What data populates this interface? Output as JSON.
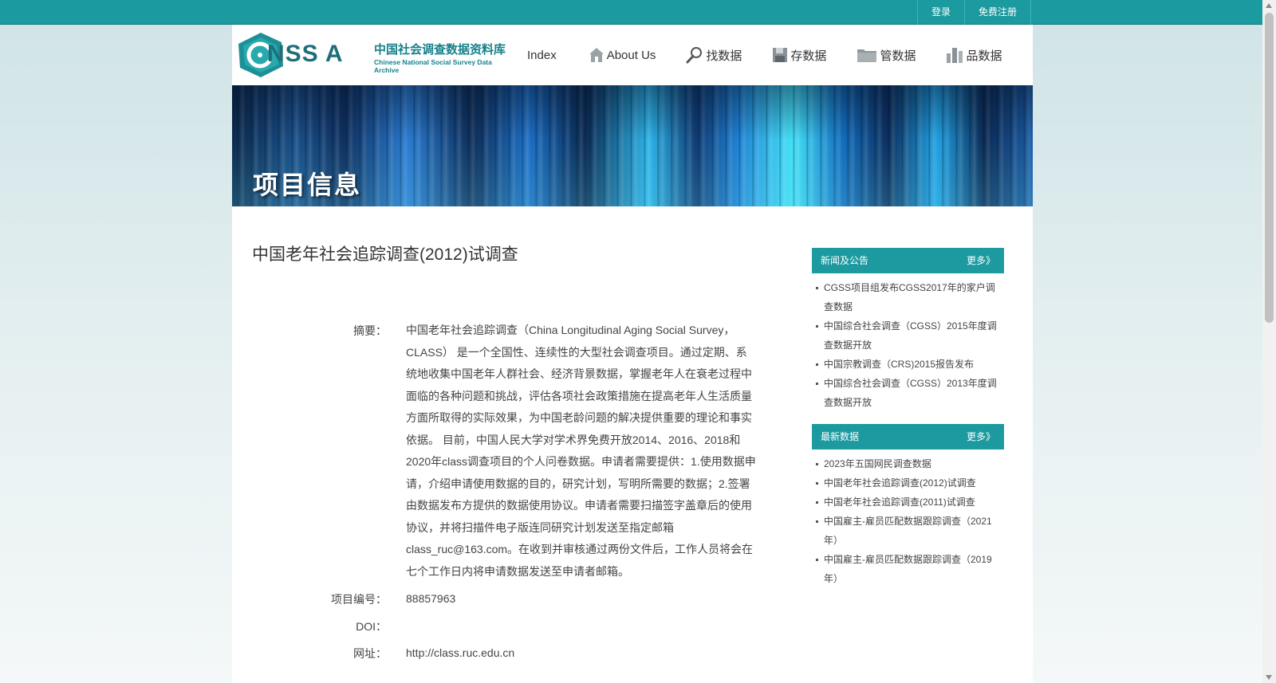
{
  "topbar": {
    "login": "登录",
    "register": "免费注册"
  },
  "logo": {
    "letters": "NSS  A",
    "cn_name": "中国社会调查数据资料库",
    "en_name": "Chinese National Social Survey Data Archive"
  },
  "nav": {
    "items": [
      {
        "label": "Index",
        "icon": "none"
      },
      {
        "label": "About Us",
        "icon": "home-icon"
      },
      {
        "label": "找数据",
        "icon": "search-icon"
      },
      {
        "label": "存数据",
        "icon": "save-icon"
      },
      {
        "label": "管数据",
        "icon": "folder-icon"
      },
      {
        "label": "品数据",
        "icon": "chart-icon"
      }
    ]
  },
  "banner": {
    "title": "项目信息"
  },
  "project": {
    "title": "中国老年社会追踪调查(2012)试调查",
    "abstract_label": "摘要：",
    "abstract": "中国老年社会追踪调查（China Longitudinal Aging Social Survey，CLASS） 是一个全国性、连续性的大型社会调查项目。通过定期、系统地收集中国老年人群社会、经济背景数据，掌握老年人在衰老过程中面临的各种问题和挑战，评估各项社会政策措施在提高老年人生活质量方面所取得的实际效果，为中国老龄问题的解决提供重要的理论和事实依据。 目前，中国人民大学对学术界免费开放2014、2016、2018和2020年class调查项目的个人问卷数据。申请者需要提供：1.使用数据申请，介绍申请使用数据的目的，研究计划，写明所需要的数据；2.签署由数据发布方提供的数据使用协议。申请者需要扫描签字盖章后的使用协议，并将扫描件电子版连同研究计划发送至指定邮箱class_ruc@163.com。在收到并审核通过两份文件后，工作人员将会在七个工作日内将申请数据发送至申请者邮箱。",
    "id_label": "项目编号：",
    "id": "88857963",
    "doi_label": "DOI：",
    "doi": "",
    "url_label": "网址：",
    "url": "http://class.ruc.edu.cn"
  },
  "sidebar": {
    "news": {
      "title": "新闻及公告",
      "more": "更多》",
      "items": [
        "CGSS项目组发布CGSS2017年的家户调查数据",
        "中国综合社会调查（CGSS）2015年度调查数据开放",
        "中国宗教调查（CRS)2015报告发布",
        "中国综合社会调查（CGSS）2013年度调查数据开放"
      ]
    },
    "latest": {
      "title": "最新数据",
      "more": "更多》",
      "items": [
        "2023年五国网民调查数据",
        "中国老年社会追踪调查(2012)试调查",
        "中国老年社会追踪调查(2011)试调查",
        "中国雇主-雇员匹配数据跟踪调查（2021年）",
        "中国雇主-雇员匹配数据跟踪调查（2019年）"
      ]
    }
  },
  "colors": {
    "teal": "#1b9aa0",
    "text": "#333333"
  }
}
